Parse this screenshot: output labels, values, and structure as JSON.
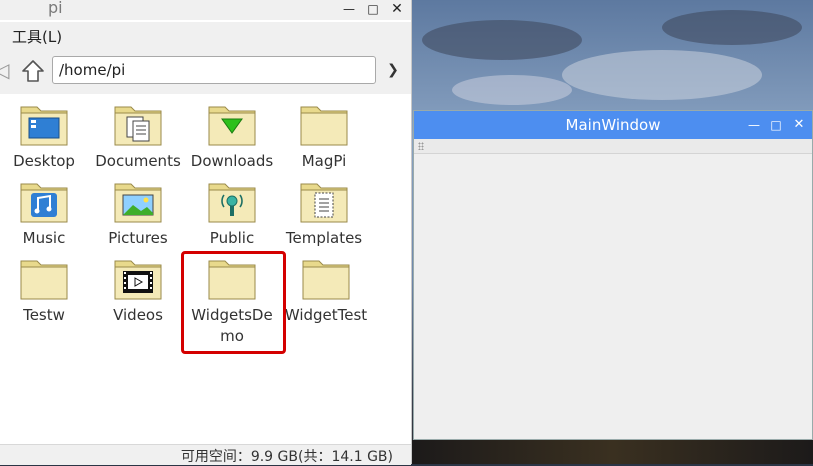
{
  "file_manager": {
    "window_title": "pi",
    "menu": {
      "tools": "工具(L)"
    },
    "toolbar": {
      "address": "/home/pi"
    },
    "items": [
      {
        "label": "Desktop",
        "icon": "desktop-folder-icon"
      },
      {
        "label": "Documents",
        "icon": "documents-folder-icon"
      },
      {
        "label": "Downloads",
        "icon": "downloads-folder-icon"
      },
      {
        "label": "MagPi",
        "icon": "folder-icon"
      },
      {
        "label": "Music",
        "icon": "music-folder-icon"
      },
      {
        "label": "Pictures",
        "icon": "pictures-folder-icon"
      },
      {
        "label": "Public",
        "icon": "public-folder-icon"
      },
      {
        "label": "Templates",
        "icon": "templates-folder-icon"
      },
      {
        "label": "Testw",
        "icon": "folder-icon"
      },
      {
        "label": "Videos",
        "icon": "videos-folder-icon"
      },
      {
        "label": "WidgetsDe\nmo",
        "icon": "folder-icon"
      },
      {
        "label": "WidgetTest",
        "icon": "folder-icon"
      }
    ],
    "status": "可用空间：9.9 GB(共：14.1 GB)"
  },
  "main_window": {
    "title": "MainWindow"
  },
  "colors": {
    "titlebar_accent": "#4d8ef0",
    "highlight": "#d40000",
    "folder": "#f1e6b0"
  }
}
